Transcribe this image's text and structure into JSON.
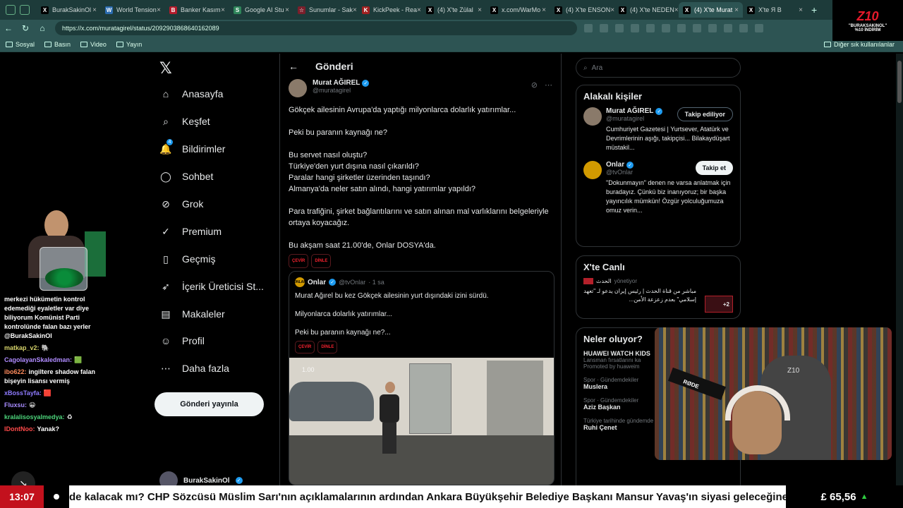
{
  "browser": {
    "tabs": [
      {
        "label": "BurakSakinOl",
        "color": "#000000",
        "glyph": "X"
      },
      {
        "label": "World Tension",
        "color": "#2b6cb0",
        "glyph": "W"
      },
      {
        "label": "Banker Kasım",
        "color": "#b31b2b",
        "glyph": "B"
      },
      {
        "label": "Google AI Stu",
        "color": "#2f855a",
        "glyph": "S"
      },
      {
        "label": "Sunumlar - Sak",
        "color": "#7a1f2b",
        "glyph": "☆"
      },
      {
        "label": "KickPeek - Rea",
        "color": "#a02020",
        "glyph": "K"
      },
      {
        "label": "(4) X'te Zülal",
        "color": "#000000",
        "glyph": "X"
      },
      {
        "label": "x.com/WarMo",
        "color": "#000000",
        "glyph": "X"
      },
      {
        "label": "(4) X'te ENSON",
        "color": "#000000",
        "glyph": "X"
      },
      {
        "label": "(4) X'te NEDEN",
        "color": "#000000",
        "glyph": "X"
      },
      {
        "label": "(4) X'te Murat",
        "color": "#000000",
        "glyph": "X"
      },
      {
        "label": "X'te Я В",
        "color": "#000000",
        "glyph": "X"
      }
    ],
    "active_tab": 10,
    "url": "https://x.com/muratagirel/status/2092903868640162089",
    "bookmarks": [
      "Sosyal",
      "Basın",
      "Video",
      "Yayın"
    ],
    "bookmarks_other": "Diğer sık kullanılanlar"
  },
  "brand": {
    "logo": "Z10",
    "line1": "\"BURAKSAKINOL\"",
    "line2": "%10 İNDİRİM"
  },
  "nav": {
    "items": [
      {
        "label": "Anasayfa",
        "icon": "home-icon",
        "glyph": "⌂"
      },
      {
        "label": "Keşfet",
        "icon": "search-icon",
        "glyph": "⌕"
      },
      {
        "label": "Bildirimler",
        "icon": "bell-icon",
        "glyph": "🔔",
        "badge": "4"
      },
      {
        "label": "Sohbet",
        "icon": "chat-icon",
        "glyph": "◯"
      },
      {
        "label": "Grok",
        "icon": "grok-icon",
        "glyph": "⊘"
      },
      {
        "label": "Premium",
        "icon": "premium-icon",
        "glyph": "✓"
      },
      {
        "label": "Geçmiş",
        "icon": "bookmark-icon",
        "glyph": "▯"
      },
      {
        "label": "İçerik Üreticisi St...",
        "icon": "rocket-icon",
        "glyph": "➶"
      },
      {
        "label": "Makaleler",
        "icon": "article-icon",
        "glyph": "▤"
      },
      {
        "label": "Profil",
        "icon": "profile-icon",
        "glyph": "☺"
      },
      {
        "label": "Daha fazla",
        "icon": "more-icon",
        "glyph": "⋯"
      }
    ],
    "post_button": "Gönderi yayınla",
    "account_name": "BurakSakinOl"
  },
  "post": {
    "header": "Gönderi",
    "author_name": "Murat AĞIREL",
    "author_handle": "@muratagirel",
    "paragraphs": [
      "Gökçek ailesinin Avrupa'da yaptığı milyonlarca dolarlık yatırımlar...",
      "Peki bu paranın kaynağı ne?",
      "Bu servet nasıl oluştu?\nTürkiye'den yurt dışına nasıl çıkarıldı?\nParalar hangi şirketler üzerinden taşındı?\nAlmanya'da neler satın alındı, hangi yatırımlar yapıldı?",
      "Para trafiğini, şirket bağlantılarını ve satın alınan mal varlıklarını belgeleriyle ortaya koyacağız.",
      "Bu akşam saat 21.00'de, Onlar DOSYA'da."
    ],
    "pill_translate": "ÇEVİR",
    "pill_listen": "DİNLE",
    "quote": {
      "name": "Onlar",
      "handle": "@tvOnlar",
      "time": "· 1 sa",
      "paragraphs": [
        "Murat Ağırel bu kez Gökçek ailesinin yurt dışındaki izini sürdü.",
        "Milyonlarca dolarlık yatırımlar...",
        "Peki bu paranın kaynağı ne?..."
      ],
      "video_time": "1.00",
      "avatar_text": "ONLAR"
    }
  },
  "right": {
    "search_placeholder": "Ara",
    "related_title": "Alakalı kişiler",
    "people": [
      {
        "name": "Murat AĞIREL",
        "handle": "@muratagirel",
        "bio": "Cumhuriyet Gazetesi | Yurtsever, Atatürk ve Devrimlerinin aşığı, takipçisi... Bilakaydüşart müstakil...",
        "button": "Takip ediliyor"
      },
      {
        "name": "Onlar",
        "handle": "@tvOnlar",
        "bio": "\"Dokunmayın\" denen ne varsa anlatmak için buradayız. Çünkü biz inanıyoruz; bir başka yayıncılık mümkün! Özgür yolculuğumuza omuz verin...",
        "button": "Takip et"
      }
    ],
    "live_title": "X'te Canlı",
    "live_source": "الحدث",
    "live_meta": "yönetiyor",
    "live_text": "مباشر من قناة الحدث | رئيس إيران يدعو لـ \"تعهد إسلامي\" بعدم زعزعة الأمن...",
    "live_plus": "+2",
    "trends_title": "Neler oluyor?",
    "trends": [
      {
        "meta": "",
        "title": "HUAWEI WATCH KIDS",
        "sub": "Lansman fırsatlarını ka"
      },
      {
        "meta": "Spor · Gündemdekiler",
        "title": "Muslera",
        "sub": ""
      },
      {
        "meta": "Spor · Gündemdekiler",
        "title": "Aziz Başkan",
        "sub": ""
      },
      {
        "meta": "Türkiye tarihinde gündemde",
        "title": "Ruhi Çenet",
        "sub": ""
      }
    ],
    "promoted": "Promoted by huaweim"
  },
  "chat": {
    "messages": [
      {
        "user": "",
        "color": "#ffffff",
        "text": "merkezi hükümetin kontrol edemediği eyaletler var diye biliyorum Komünist Parti kontrolünde falan bazı yerler @BurakSakinOl"
      },
      {
        "user": "matkap_v2:",
        "color": "#d6d36a",
        "text": "🐘"
      },
      {
        "user": "CagolayanSkaledman:",
        "color": "#b08cff",
        "text": "🟩"
      },
      {
        "user": "ibo622:",
        "color": "#ff8b5c",
        "text": "ingiltere shadow falan bişeyin lisansı vermiş"
      },
      {
        "user": "xBossTayfa:",
        "color": "#8f7bff",
        "text": "🟥"
      },
      {
        "user": "Fluxsu:",
        "color": "#a88cff",
        "text": "😀"
      },
      {
        "user": "kralalisosyalmedya:",
        "color": "#4cd37a",
        "text": "♻"
      },
      {
        "user": "IDontNoo:",
        "color": "#ff4a4a",
        "text": "Yanak?"
      }
    ]
  },
  "webcam": {
    "mic_label": "RØDE",
    "chair_logo": "Z10"
  },
  "ticker": {
    "clock": "13:07",
    "text": "de kalacak mı? CHP Sözcüsü Müslim Sarı'nın açıklamalarının ardından Ankara Büyükşehir Belediye Başkanı Mansur Yavaş'ın siyasi geleceğine ilişkin tartışma",
    "price": "£ 65,56",
    "arrow": "▲"
  }
}
